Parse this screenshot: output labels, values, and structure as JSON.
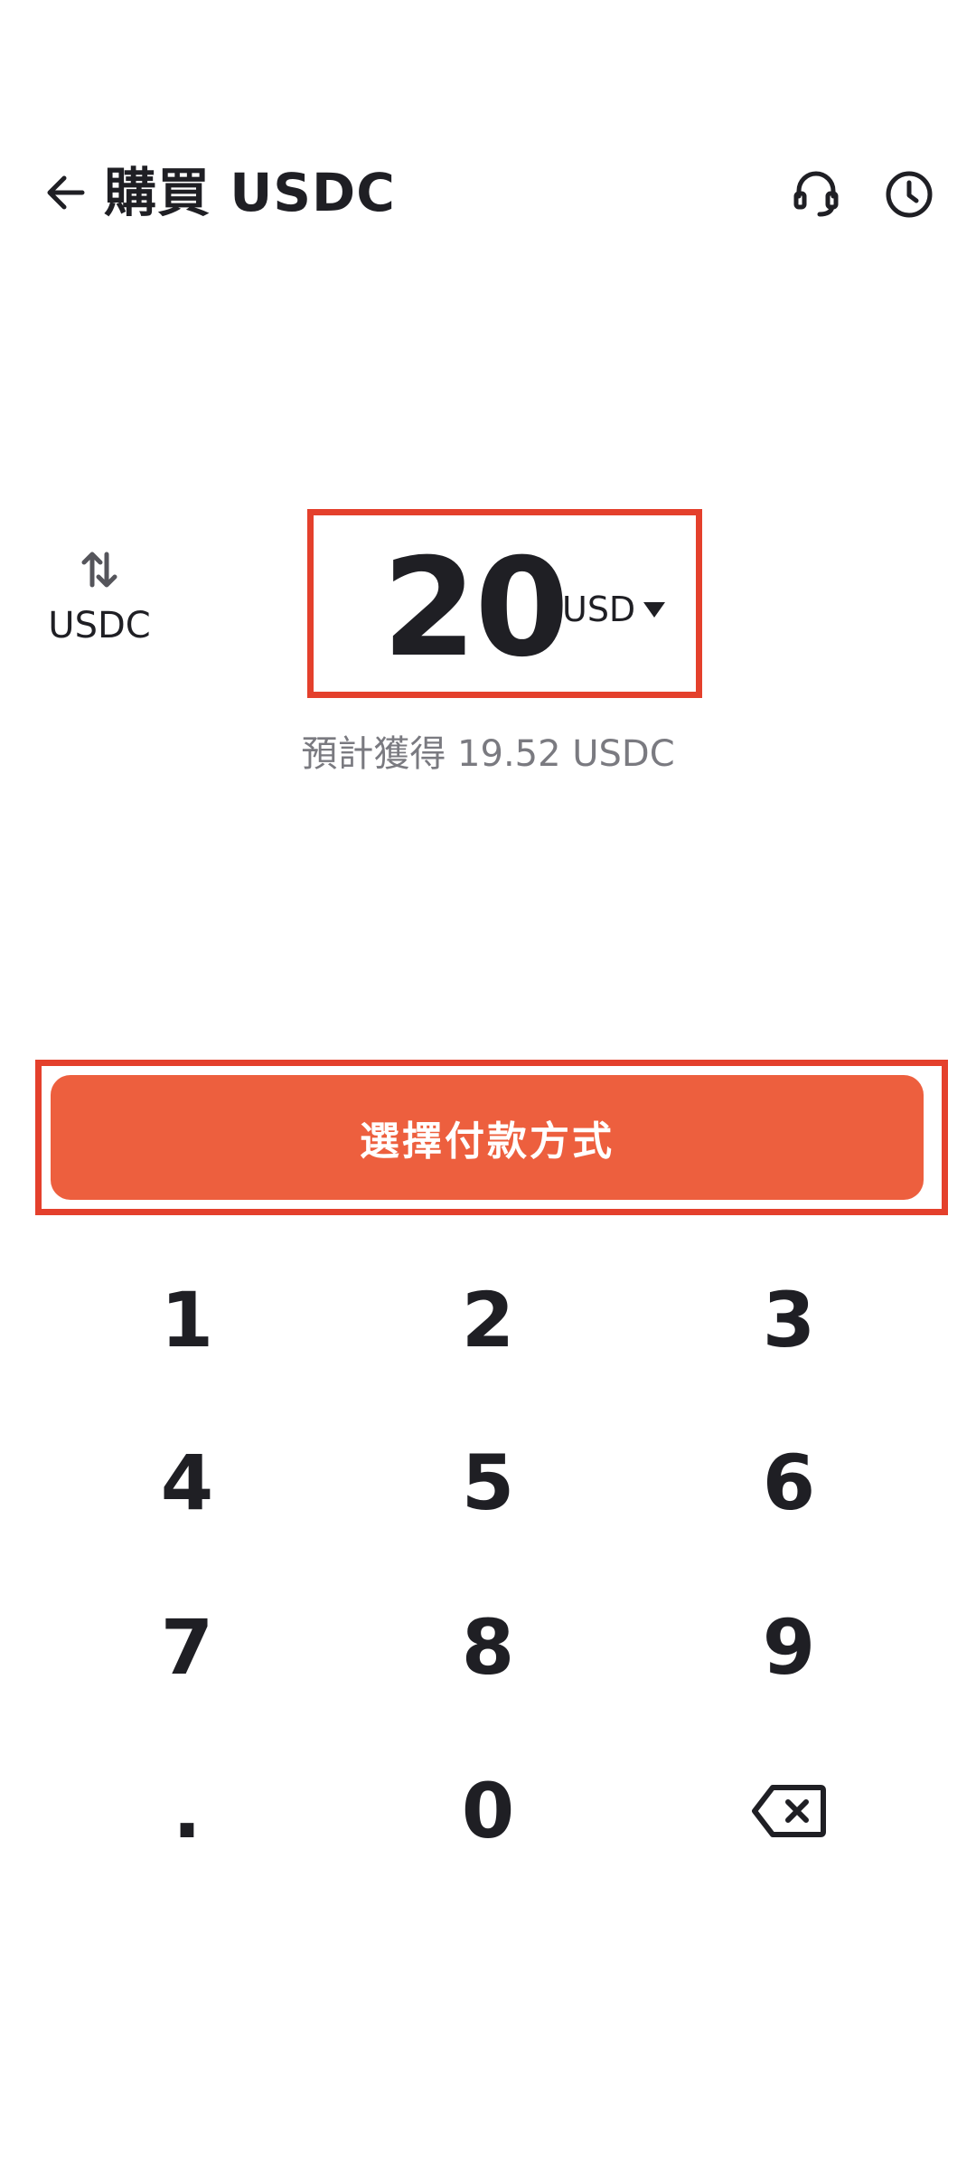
{
  "header": {
    "title": "購買 USDC",
    "back_icon": "arrow-left-icon",
    "support_icon": "headset-icon",
    "history_icon": "clock-icon"
  },
  "swap": {
    "icon": "swap-vertical-icon",
    "label": "USDC"
  },
  "amount": {
    "value": "20",
    "currency": "USD",
    "currency_icon": "caret-down-icon"
  },
  "estimate_text": "預計獲得 19.52 USDC",
  "cta": {
    "label": "選擇付款方式"
  },
  "keypad": {
    "keys": [
      "1",
      "2",
      "3",
      "4",
      "5",
      "6",
      "7",
      "8",
      "9",
      ".",
      "0"
    ],
    "delete_icon": "backspace-icon"
  },
  "colors": {
    "accent": "#ed5f3e",
    "highlight": "#e4402c",
    "text": "#1f1f24",
    "muted": "#7a7a80",
    "background": "#ffffff"
  }
}
